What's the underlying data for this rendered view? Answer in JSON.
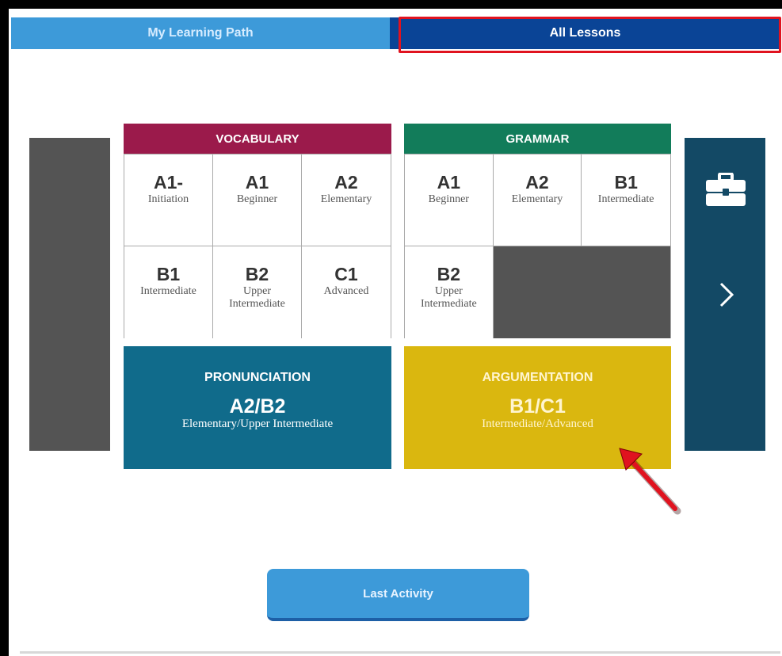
{
  "tabs": {
    "my_learning_path": "My Learning Path",
    "all_lessons": "All Lessons"
  },
  "vocabulary": {
    "title": "VOCABULARY",
    "levels": [
      {
        "code": "A1-",
        "name": "Initiation"
      },
      {
        "code": "A1",
        "name": "Beginner"
      },
      {
        "code": "A2",
        "name": "Elementary"
      },
      {
        "code": "B1",
        "name": "Intermediate"
      },
      {
        "code": "B2",
        "name": "Upper Intermediate"
      },
      {
        "code": "C1",
        "name": "Advanced"
      }
    ]
  },
  "grammar": {
    "title": "GRAMMAR",
    "levels": [
      {
        "code": "A1",
        "name": "Beginner"
      },
      {
        "code": "A2",
        "name": "Elementary"
      },
      {
        "code": "B1",
        "name": "Intermediate"
      },
      {
        "code": "B2",
        "name": "Upper Intermediate"
      }
    ]
  },
  "pronunciation": {
    "title": "PRONUNCIATION",
    "level": "A2/B2",
    "desc": "Elementary/Upper Intermediate"
  },
  "argumentation": {
    "title": "ARGUMENTATION",
    "level": "B1/C1",
    "desc": "Intermediate/Advanced"
  },
  "icons": {
    "briefcase": "briefcase-icon",
    "next": "chevron-right-icon",
    "pointer": "red-arrow-icon"
  },
  "colors": {
    "tab_inactive": "#3d9ad9",
    "tab_active": "#0a4496",
    "highlight": "#e0131f",
    "vocabulary": "#9b1a4b",
    "grammar": "#127c5a",
    "pronunciation": "#106b8b",
    "argumentation": "#dab70f",
    "side_panel": "#134965",
    "button": "#3d9ad9"
  },
  "buttons": {
    "last_activity": "Last Activity"
  }
}
